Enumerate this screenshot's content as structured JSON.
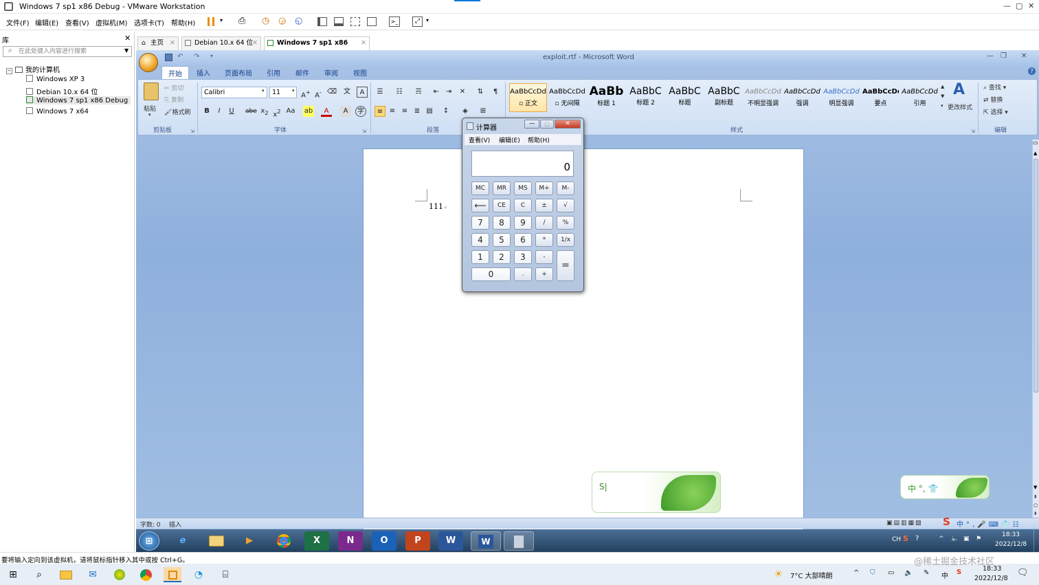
{
  "vmware": {
    "title": "Windows 7 sp1 x86 Debug - VMware Workstation",
    "menus": [
      "文件(F)",
      "编辑(E)",
      "查看(V)",
      "虚拟机(M)",
      "选项卡(T)",
      "帮助(H)"
    ],
    "library_title": "库",
    "search_placeholder": "在此处键入内容进行搜索",
    "tree_root": "我的计算机",
    "vms": [
      "Windows XP 3",
      "Debian 10.x 64 位",
      "Windows 7 sp1 x86 Debug",
      "Windows 7 x64"
    ],
    "tabs": [
      "主页",
      "Debian 10.x 64 位",
      "Windows 7 sp1 x86 Debug"
    ],
    "status_text": "要将输入定向到该虚拟机，请将鼠标指针移入其中或按 Ctrl+G。"
  },
  "word": {
    "title": "exploit.rtf - Microsoft Word",
    "tabs": [
      "开始",
      "插入",
      "页面布局",
      "引用",
      "邮件",
      "审阅",
      "视图"
    ],
    "clipboard": {
      "paste": "粘贴",
      "cut": "剪切",
      "copy": "复制",
      "format_painter": "格式刷",
      "label": "剪贴板"
    },
    "font": {
      "name": "Calibri",
      "size": "11",
      "label": "字体"
    },
    "paragraph_label": "段落",
    "styles": [
      {
        "preview": "AaBbCcDd",
        "name": "▫ 正文"
      },
      {
        "preview": "AaBbCcDd",
        "name": "▫ 无间隔"
      },
      {
        "preview": "AaBb",
        "name": "标题 1"
      },
      {
        "preview": "AaBbC",
        "name": "标题 2"
      },
      {
        "preview": "AaBbC",
        "name": "标题"
      },
      {
        "preview": "AaBbC",
        "name": "副标题"
      },
      {
        "preview": "AaBbCcDd",
        "name": "不明显强调"
      },
      {
        "preview": "AaBbCcDd",
        "name": "强调"
      },
      {
        "preview": "AaBbCcDd",
        "name": "明显强调"
      },
      {
        "preview": "AaBbCcDd",
        "name": "要点"
      },
      {
        "preview": "AaBbCcDd",
        "name": "引用"
      }
    ],
    "change_styles": "更改样式",
    "styles_label": "样式",
    "editing": {
      "find": "查找",
      "replace": "替换",
      "select": "选择",
      "label": "编辑"
    },
    "doc_text": "111",
    "status_words": "字数: 0",
    "status_mode": "插入"
  },
  "calculator": {
    "title": "计算器",
    "menus": [
      "查看(V)",
      "编辑(E)",
      "帮助(H)"
    ],
    "display": "0",
    "keys": {
      "mc": "MC",
      "mr": "MR",
      "ms": "MS",
      "mplus": "M+",
      "mminus": "M-",
      "back": "⟵",
      "ce": "CE",
      "c": "C",
      "pm": "±",
      "sqrt": "√",
      "k7": "7",
      "k8": "8",
      "k9": "9",
      "div": "/",
      "pct": "%",
      "k4": "4",
      "k5": "5",
      "k6": "6",
      "mul": "*",
      "inv": "1/x",
      "k1": "1",
      "k2": "2",
      "k3": "3",
      "sub": "-",
      "eq": "=",
      "k0": "0",
      "dot": ".",
      "add": "+"
    }
  },
  "ime": {
    "input": "S|",
    "small": "中 °, 👕"
  },
  "guest_tray": {
    "lang": "CH",
    "time": "18:33",
    "date": "2022/12/8"
  },
  "host_tray": {
    "weather": "7°C 大部晴朗",
    "ime_lang": "中",
    "time": "18:33",
    "date": "2022/12/8",
    "watermark": "@稀土掘金技术社区"
  }
}
